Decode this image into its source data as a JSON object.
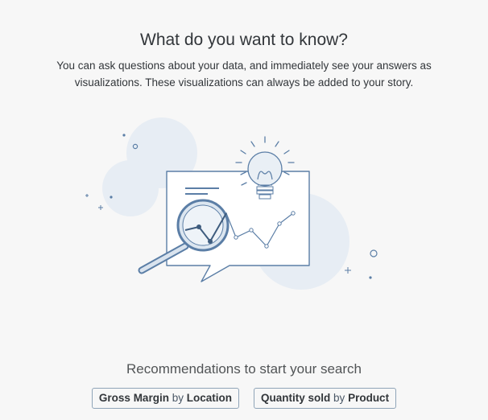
{
  "header": {
    "title": "What do you want to know?",
    "description": "You can ask questions about your data, and immediately see your answers as visualizations. These visualizations can always be added to your story."
  },
  "illustration": {
    "icon": "magnifier-chart-lightbulb-icon"
  },
  "recommendations": {
    "heading": "Recommendations to start your search",
    "items": [
      {
        "measure": "Gross Margin",
        "connector": "by",
        "dimension": "Location"
      },
      {
        "measure": "Quantity sold",
        "connector": "by",
        "dimension": "Product"
      }
    ]
  },
  "colors": {
    "background": "#f7f7f7",
    "accent": "#5b7ea6",
    "soft_circle": "#e4ebf3"
  }
}
